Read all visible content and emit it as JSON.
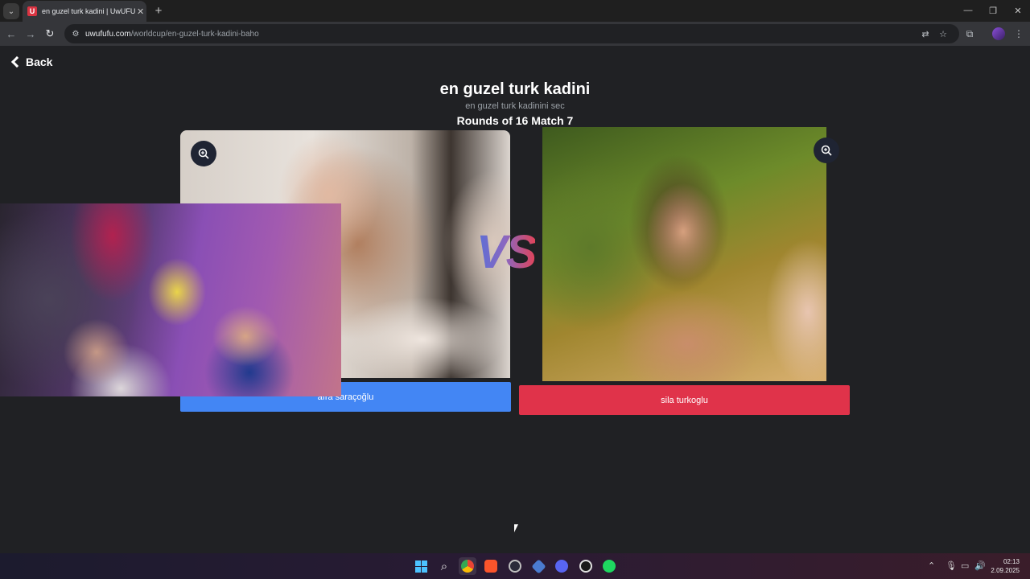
{
  "browser": {
    "tab_title": "en guzel turk kadini | UwUFUFU",
    "favicon_letter": "U",
    "url_host": "uwufufu.com",
    "url_path": "/worldcup/en-guzel-turk-kadini-baho",
    "icons": [
      "tab-dropdown-icon",
      "close-icon",
      "plus-icon",
      "minimize-icon",
      "restore-icon",
      "close-window-icon",
      "back-arrow-icon",
      "forward-arrow-icon",
      "reload-icon",
      "site-info-icon",
      "translate-icon",
      "star-icon",
      "extensions-icon",
      "profile-avatar",
      "kebab-menu-icon"
    ]
  },
  "page": {
    "back_label": "Back",
    "title": "en guzel turk kadini",
    "subtitle": "en guzel turk kadinini sec",
    "round": "Rounds of 16 Match 7",
    "vs": "VS",
    "left_choice": "afra saraçoğlu",
    "right_choice": "sila turkoglu",
    "colors": {
      "left_button": "#4386f4",
      "right_button": "#e0334a",
      "background": "#202124"
    }
  },
  "taskbar": {
    "time": "02:13",
    "date": "2.09.2025",
    "apps": [
      "windows-start-icon",
      "search-icon",
      "chrome-icon",
      "brave-icon",
      "app-icon",
      "app-icon-2",
      "discord-icon",
      "obs-icon",
      "spotify-icon"
    ]
  }
}
